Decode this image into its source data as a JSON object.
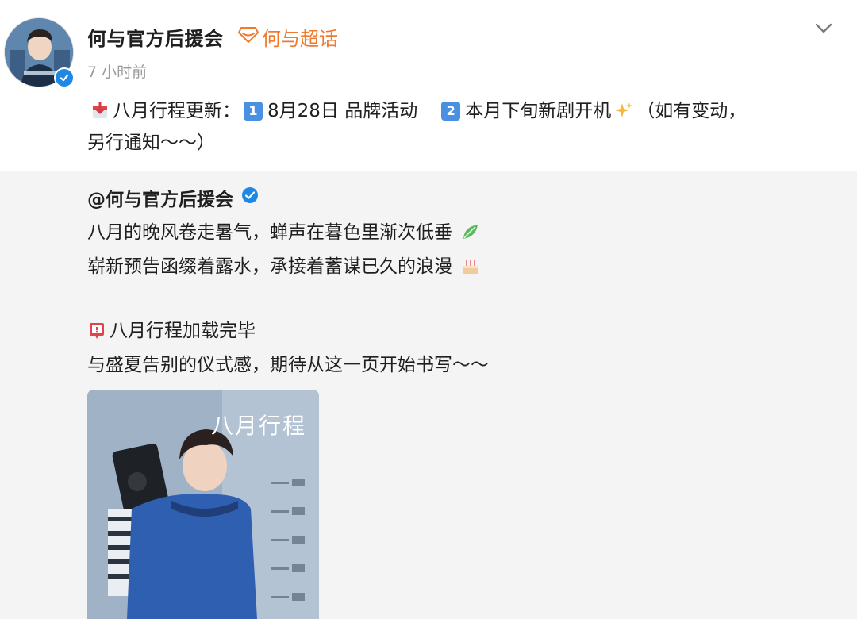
{
  "post": {
    "author": "何与官方后援会",
    "super_topic": "何与超话",
    "time": "7 小时前",
    "text_line1_a": "八月行程更新：",
    "item1_num": "1",
    "item1_text": "8月28日 品牌活动",
    "item2_num": "2",
    "item2_text": "本月下旬新剧开机",
    "text_line1_tail": "（如有变动，",
    "text_line2": "另行通知～～）",
    "icons": {
      "calendar": "calendar-download-icon",
      "sparkles": "sparkles-icon",
      "chevron": "chevron-down-icon",
      "super_topic": "diamond-icon",
      "verified": "verified-icon"
    }
  },
  "retweet": {
    "author": "@何与官方后援会",
    "line1": "八月的晚风卷走暑气，蝉声在暮色里渐次低垂",
    "line2": "崭新预告函缀着露水，承接着蓄谋已久的浪漫",
    "line3": "八月行程加载完毕",
    "line4": "与盛夏告别的仪式感，期待从这一页开始书写～～",
    "image_title": "八月行程",
    "icons": {
      "leaf": "leaf-icon",
      "cake": "cake-icon",
      "calendar": "calendar-pin-icon"
    }
  },
  "colors": {
    "accent_orange": "#f07b2f",
    "verified_blue": "#1e88e5",
    "number_badge": "#4a90e2",
    "retweet_bg": "#f4f4f4"
  }
}
